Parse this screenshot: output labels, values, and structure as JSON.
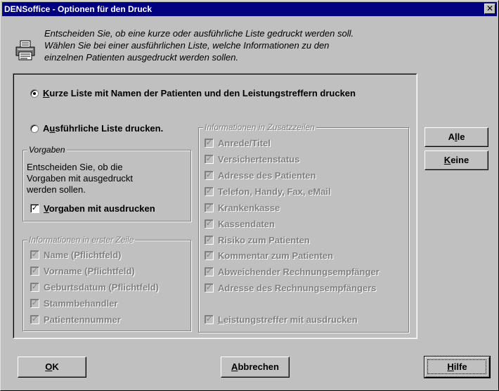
{
  "window": {
    "title": "DENSoffice - Optionen für den Druck",
    "close_label": "✕"
  },
  "intro": [
    "Entscheiden Sie, ob eine kurze oder ausführliche Liste gedruckt werden soll.",
    "Wählen Sie bei einer ausführlichen Liste, welche Informationen zu den",
    "einzelnen Patienten ausgedruckt werden sollen."
  ],
  "options": {
    "short_list": {
      "accel": "K",
      "rest": "urze Liste mit Namen der Patienten und den Leistungstreffern drucken",
      "selected": true
    },
    "long_list": {
      "pre": "A",
      "accel": "u",
      "rest": "sführliche Liste drucken.",
      "selected": false
    }
  },
  "vorgaben": {
    "title": "Vorgaben",
    "text": [
      "Entscheiden Sie, ob die",
      "Vorgaben mit ausgedruckt",
      "werden sollen."
    ],
    "checkbox": {
      "accel": "V",
      "rest": "orgaben mit ausdrucken",
      "checked": true
    }
  },
  "first_line": {
    "title": "Informationen in erster Zeile",
    "items": [
      {
        "label": "Name (Pflichtfeld)",
        "checked": true
      },
      {
        "label": "Vorname (Pflichtfeld)",
        "checked": true
      },
      {
        "label": "Geburtsdatum (Pflichtfeld)",
        "checked": true
      },
      {
        "label": "Stammbehandler",
        "checked": true
      },
      {
        "label": "Patientennummer",
        "checked": true
      }
    ]
  },
  "extra_lines": {
    "title": "Informationen in Zusatzzeilen",
    "items": [
      {
        "label": "Anrede/Titel",
        "checked": true
      },
      {
        "label": "Versichertenstatus",
        "checked": true
      },
      {
        "label": "Adresse des Patienten",
        "checked": true
      },
      {
        "label": "Telefon, Handy, Fax, eMail",
        "checked": true
      },
      {
        "label": "Krankenkasse",
        "checked": true
      },
      {
        "label": "Kassendaten",
        "checked": true
      },
      {
        "label": "Risiko zum Patienten",
        "checked": true
      },
      {
        "label": "Kommentar zum Patienten",
        "checked": true
      },
      {
        "label": "Abweichender Rechnungsempfänger",
        "checked": true
      },
      {
        "label": "Adresse des Rechnungsempfängers",
        "checked": true
      }
    ],
    "leistung": {
      "accel": "L",
      "rest": "eistungstreffer mit ausdrucken",
      "checked": true
    }
  },
  "buttons": {
    "alle": {
      "pre": "A",
      "accel": "l",
      "rest": "le"
    },
    "keine": {
      "accel": "K",
      "rest": "eine"
    },
    "ok": {
      "accel": "O",
      "rest": "K"
    },
    "abbrechen": {
      "accel": "A",
      "rest": "bbrechen"
    },
    "hilfe": {
      "accel": "H",
      "rest": "ilfe"
    }
  },
  "colors": {
    "face": "#c0c0c0",
    "title_bar": "#000080",
    "disabled_text": "#808080"
  },
  "icons": {
    "dialog": "printer-icon"
  }
}
